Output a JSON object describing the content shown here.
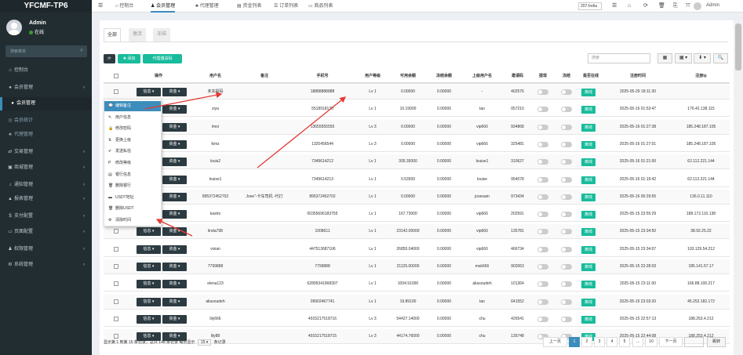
{
  "app": {
    "logo": "YFCMF-TP6"
  },
  "user": {
    "name": "Admin",
    "status": "在线"
  },
  "sidebar": {
    "search_placeholder": "搜索菜单",
    "items": [
      {
        "icon": "⌂",
        "label": "控制台"
      },
      {
        "icon": "●",
        "label": "会员管理"
      },
      {
        "icon": "●",
        "label": "会员管理"
      },
      {
        "icon": "◎",
        "label": "会员统计"
      },
      {
        "icon": "♣",
        "label": "代理管理"
      },
      {
        "icon": "⇄",
        "label": "交易管理"
      },
      {
        "icon": "▣",
        "label": "商城管理"
      },
      {
        "icon": "♪",
        "label": "通知管理"
      },
      {
        "icon": "▲",
        "label": "报表管理"
      },
      {
        "icon": "$",
        "label": "支付配置"
      },
      {
        "icon": "▭",
        "label": "页面配置"
      },
      {
        "icon": "♟",
        "label": "权限管理"
      },
      {
        "icon": "⚙",
        "label": "系统管理"
      }
    ]
  },
  "topnav": {
    "tabs": [
      {
        "icon": "⌂",
        "label": "控制台"
      },
      {
        "icon": "♟",
        "label": "会员管理"
      },
      {
        "icon": "♣",
        "label": "代理管理"
      },
      {
        "icon": "▤",
        "label": "资金列表"
      },
      {
        "icon": "☰",
        "label": "订单列表"
      },
      {
        "icon": "▭",
        "label": "商品列表"
      }
    ],
    "lang": "207-India",
    "admin": "Admin",
    "icons": [
      "☰",
      "⌂",
      "⟳",
      "🗑",
      "⎘",
      "⤧"
    ]
  },
  "filter_tabs": [
    "全部",
    "激活",
    "冻结"
  ],
  "toolbar": {
    "refresh": "⟳",
    "add": "✚ 添加",
    "agent_code": "代理邀请码"
  },
  "search": {
    "placeholder": "搜索"
  },
  "right_buttons": [
    "▦",
    "▦ ▾",
    "⬇ ▾",
    "🔍"
  ],
  "table": {
    "headers": [
      "",
      "操作",
      "用户名",
      "备注",
      "手机号",
      "用户等级",
      "可用余额",
      "冻结余额",
      "上级用户名",
      "邀请码",
      "提现",
      "冻结",
      "是否在线",
      "注册时间",
      "注册ip"
    ],
    "btn_info": "信息",
    "btn_funds": "资金",
    "online_label": "离线",
    "rows": [
      {
        "username": "未充提码",
        "remark": "",
        "phone": "18888888888",
        "level": "Lv 1",
        "balance": "0.00000",
        "frozen": "0.00000",
        "parent": "-",
        "invite": "402576",
        "reg_time": "2025-05-29 18:11:30",
        "ip": ""
      },
      {
        "username": "ziya",
        "remark": "",
        "phone": "5518918130",
        "level": "Lv 1",
        "balance": "10.19000",
        "frozen": "0.00000",
        "parent": "tao",
        "invite": "057210",
        "reg_time": "2025-05-16 01:53:47",
        "ip": "176.42.138.115"
      },
      {
        "username": "lmoi",
        "remark": "",
        "phone": "13655555555",
        "level": "Lv 3",
        "balance": "0.00000",
        "frozen": "0.00000",
        "parent": "vip666",
        "invite": "934868",
        "reg_time": "2025-05-16 01:27:38",
        "ip": "185.248.187.105"
      },
      {
        "username": "lkmz",
        "remark": "",
        "phone": "1325456544",
        "level": "Lv 3",
        "balance": "0.00000",
        "frozen": "0.00000",
        "parent": "vip666",
        "invite": "325481",
        "reg_time": "2025-05-16 01:27:01",
        "ip": "185.248.187.105"
      },
      {
        "username": "louis2",
        "remark": "",
        "phone": "7349614212",
        "level": "Lv 1",
        "balance": "305.35000",
        "frozen": "0.00000",
        "parent": "louise1",
        "invite": "310627",
        "reg_time": "2025-05-16 01:21:00",
        "ip": "62.112.221.144"
      },
      {
        "username": "louise1",
        "remark": "",
        "phone": "7349614213",
        "level": "Lv 1",
        "balance": "0.53500",
        "frozen": "0.00000",
        "parent": "louise",
        "invite": "954078",
        "reg_time": "2025-05-16 01:19:42",
        "ip": "62.112.221.144"
      },
      {
        "username": "895372452702",
        "remark": "Jose\"-卡车司机 -代打",
        "phone": "895372452702",
        "level": "Lv 1",
        "balance": "0.00000",
        "frozen": "0.00000",
        "parent": "josesam",
        "invite": "973434",
        "reg_time": "2025-05-16 00:29:55",
        "ip": "136.0.11.110"
      },
      {
        "username": "kastro",
        "remark": "",
        "phone": "00355696183755",
        "level": "Lv 1",
        "balance": "167.73000",
        "frozen": "0.00000",
        "parent": "vip666",
        "invite": "202591",
        "reg_time": "2025-05-15 23:55:29",
        "ip": "188.172.110.138"
      },
      {
        "username": "linda798",
        "remark": "",
        "phone": "1008611",
        "level": "Lv 1",
        "balance": "23142.00000",
        "frozen": "0.00000",
        "parent": "vip666",
        "invite": "135781",
        "reg_time": "2025-05-15 23:34:50",
        "ip": "38.92.25.22"
      },
      {
        "username": "vivian",
        "remark": "",
        "phone": "447513687106",
        "level": "Lv 1",
        "balance": "26855.04000",
        "frozen": "0.00000",
        "parent": "vip666",
        "invite": "466734",
        "reg_time": "2025-05-15 23:34:07",
        "ip": "103.129.54.212"
      },
      {
        "username": "7799888",
        "remark": "",
        "phone": "7799888",
        "level": "Lv 1",
        "balance": "21125.00000",
        "frozen": "0.00000",
        "parent": "msk666",
        "invite": "902063",
        "reg_time": "2025-05-15 23:28:03",
        "ip": "185.141.57.17"
      },
      {
        "username": "elena123",
        "remark": "",
        "phone": "62895341968307",
        "level": "Lv 1",
        "balance": "1004.91000",
        "frozen": "0.00000",
        "parent": "aliasoudeh",
        "invite": "101364",
        "reg_time": "2025-05-15 23:11:00",
        "ip": "166.88.100.217"
      },
      {
        "username": "aliasoudeh",
        "remark": "",
        "phone": "09902467741",
        "level": "Lv 1",
        "balance": "19.89100",
        "frozen": "0.00000",
        "parent": "tao",
        "invite": "641552",
        "reg_time": "2025-05-15 23:03:20",
        "ip": "45.252.182.172"
      },
      {
        "username": "lily666",
        "remark": "",
        "phone": "4915217518716",
        "level": "Lv 3",
        "balance": "54427.14000",
        "frozen": "0.00000",
        "parent": "chu",
        "invite": "426541",
        "reg_time": "2025-05-15 22:57:13",
        "ip": "188.253.4.212"
      },
      {
        "username": "lily88",
        "remark": "",
        "phone": "4915217518715",
        "level": "Lv 3",
        "balance": "44174.76000",
        "frozen": "0.00000",
        "parent": "chu",
        "invite": "135748",
        "reg_time": "2025-05-15 22:44:08",
        "ip": "188.253.4.212"
      }
    ]
  },
  "dropdown": [
    {
      "icon": "💬",
      "label": "编辑备注"
    },
    {
      "icon": "✎",
      "label": "用户信息"
    },
    {
      "icon": "🔒",
      "label": "修改密码"
    },
    {
      "icon": "⇅",
      "label": "更换上级"
    },
    {
      "icon": "✔",
      "label": "发送私信"
    },
    {
      "icon": "P",
      "label": "修改等级"
    },
    {
      "icon": "▤",
      "label": "银行信息"
    },
    {
      "icon": "🗑",
      "label": "删除银行"
    },
    {
      "icon": "▬",
      "label": "USDT地址"
    },
    {
      "icon": "🗑",
      "label": "删除USDT"
    },
    {
      "icon": "⚙",
      "label": "清除时间"
    }
  ],
  "footer": {
    "info_before": "显示第 1 到第 15 条记录，总共 148 条记录 每页显示",
    "page_size": "15 ▾",
    "info_after": "条记录"
  },
  "pagination": [
    "上一页",
    "1",
    "2",
    "3",
    "4",
    "5",
    "...",
    "10",
    "下一页"
  ],
  "jump": "跳转",
  "colors": {
    "sidebar": "#222d32",
    "accent": "#3c8dbc",
    "green": "#18bc9c",
    "annotation": "#e53935"
  }
}
